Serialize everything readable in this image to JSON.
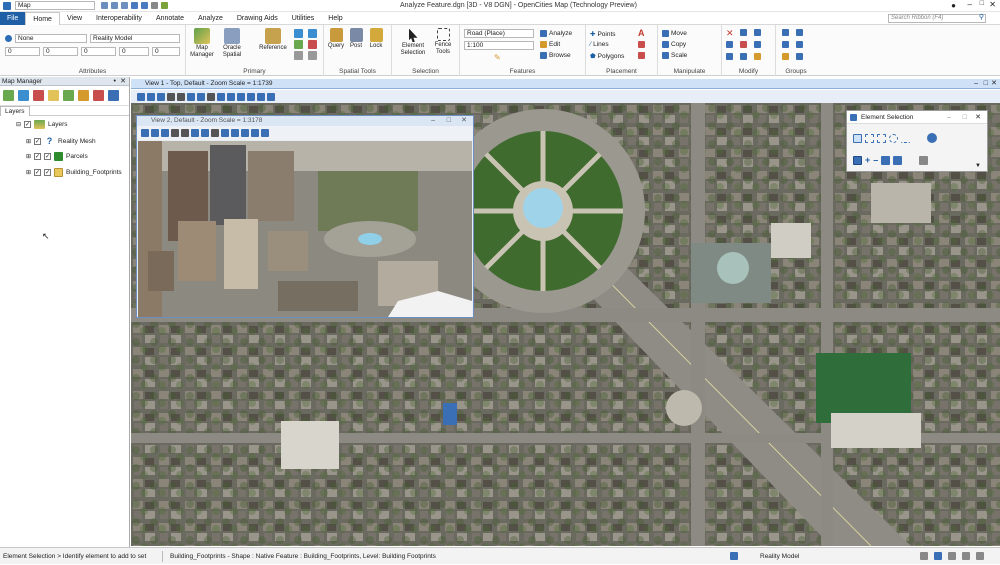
{
  "titlebar": {
    "workflow": "Map",
    "title": "Analyze Feature.dgn [3D - V8 DGN] - OpenCities Map (Technology Preview)"
  },
  "tabs": [
    "File",
    "Home",
    "View",
    "Interoperability",
    "Annotate",
    "Analyze",
    "Drawing Aids",
    "Utilities",
    "Help"
  ],
  "search": {
    "placeholder": "Search Ribbon (F4)"
  },
  "ribbon": {
    "attributes": {
      "label": "Attributes",
      "level": "None",
      "model": "Reality Model",
      "row2": [
        "0",
        "0",
        "0",
        "0",
        "0"
      ]
    },
    "primary": {
      "label": "Primary",
      "items": [
        "Map Manager",
        "Oracle Spatial",
        "Reference"
      ]
    },
    "spatial": {
      "label": "Spatial Tools",
      "items": [
        "Query",
        "Post",
        "Lock"
      ]
    },
    "selection": {
      "label": "Selection",
      "items": [
        "Element Selection",
        "Fence Tools"
      ]
    },
    "features": {
      "label": "Features",
      "road": "Road (Place)",
      "scale": "1:100",
      "items": [
        "Analyze",
        "Edit",
        "Browse"
      ]
    },
    "placement": {
      "label": "Placement",
      "items": [
        "Points",
        "Lines",
        "Polygons"
      ]
    },
    "manipulate": {
      "label": "Manipulate",
      "items": [
        "Move",
        "Copy",
        "Scale"
      ]
    },
    "modify": {
      "label": "Modify"
    },
    "groups": {
      "label": "Groups"
    }
  },
  "mapmanager": {
    "title": "Map Manager",
    "tab": "Layers",
    "layers": [
      {
        "name": "Layers",
        "icon": "layers-icon"
      },
      {
        "name": "Reality Mesh",
        "icon": "question-icon"
      },
      {
        "name": "Parcels",
        "icon": "parcel-icon",
        "color": "#2e8b2e"
      },
      {
        "name": "Building_Footprints",
        "icon": "building-icon",
        "color": "#e8c95a"
      }
    ]
  },
  "view1": {
    "title": "View 1 - Top, Default - Zoom Scale = 1:1739"
  },
  "view2": {
    "title": "View 2, Default - Zoom Scale = 1:3178"
  },
  "element_selection": {
    "title": "Element Selection"
  },
  "status": {
    "prompt": "Element Selection > Identify element to add to set",
    "info": "Building_Footprints - Shape : Native Feature : Building_Footprints, Level: Building Footprints",
    "model": "Reality Model"
  },
  "colors": {
    "accent": "#1f5fa6",
    "view_title": "#cfe1f7"
  }
}
